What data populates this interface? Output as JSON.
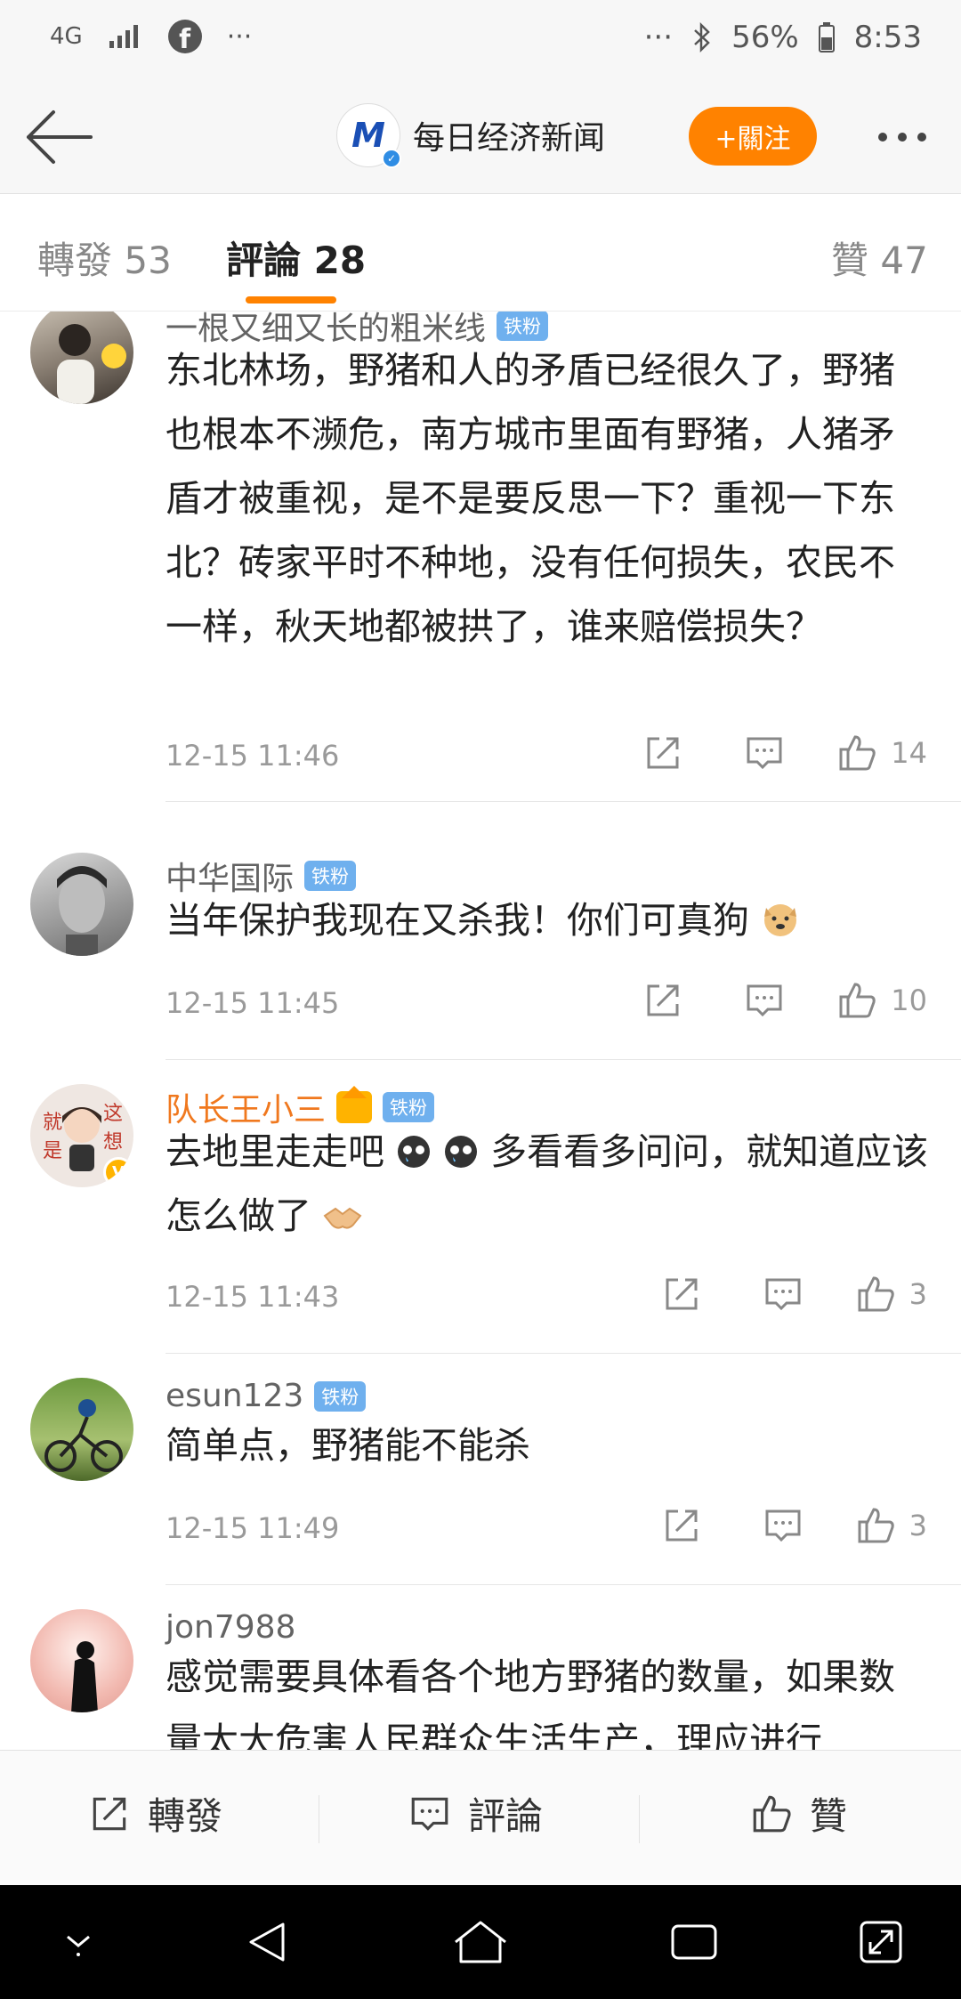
{
  "status_bar": {
    "network": "4G",
    "more_left": "···",
    "more_right": "···",
    "battery": "56%",
    "time": "8:53"
  },
  "header": {
    "account_name": "每日经济新闻",
    "follow_label": "+關注"
  },
  "tabs": {
    "repost": "轉發 53",
    "comments": "評論 28",
    "likes": "贊 47"
  },
  "comments": [
    {
      "user": "一根又细又长的粗米线",
      "badge": "铁粉",
      "text": "东北林场，野猪和人的矛盾已经很久了，野猪也根本不濒危，南方城市里面有野猪，人猪矛盾才被重视，是不是要反思一下？重视一下东北？砖家平时不种地，没有任何损失，农民不一样，秋天地都被拱了，谁来赔偿损失？",
      "time": "12-15 11:46",
      "likes": "14"
    },
    {
      "user": "中华国际",
      "badge": "铁粉",
      "text": "当年保护我现在又杀我！你们可真狗",
      "time": "12-15 11:45",
      "likes": "10"
    },
    {
      "user": "队长王小三",
      "badge": "铁粉",
      "text_part1": "去地里走走吧",
      "text_part2": "多看看多问问，就知道应该怎么做了",
      "avatar_text_1": "就",
      "avatar_text_2": "是",
      "avatar_text_3": "这",
      "avatar_text_4": "想",
      "time": "12-15 11:43",
      "likes": "3"
    },
    {
      "user": "esun123",
      "badge": "铁粉",
      "text": "简单点，野猪能不能杀",
      "time": "12-15 11:49",
      "likes": "3"
    },
    {
      "user": "jon7988",
      "text": "感觉需要具体看各个地方野猪的数量，如果数量太大危害人民群众生活生产，理应进行"
    }
  ],
  "toolbar": {
    "repost": "轉發",
    "comment": "評論",
    "like": "贊"
  },
  "colors": {
    "accent": "#ff8200",
    "fan_badge": "#6fb0ee",
    "vip_name": "#f0781e"
  }
}
